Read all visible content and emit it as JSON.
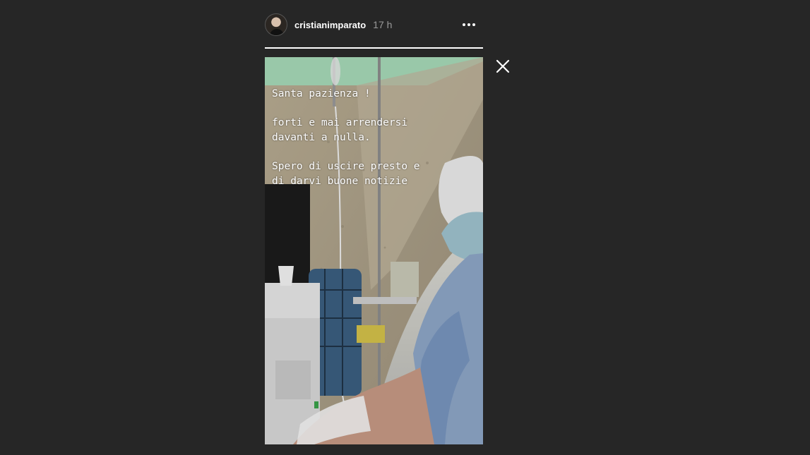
{
  "header": {
    "username": "cristianimparato",
    "time": "17 h"
  },
  "story": {
    "progress": 1.0,
    "lines": [
      "Santa pazienza !",
      "forti e mai arrendersi\ndavanti a nulla.",
      "Spero di uscire presto e\ndi darvi buone notizie"
    ]
  },
  "icons": {
    "more": "more-options-icon",
    "close": "close-icon",
    "avatar": "avatar"
  },
  "colors": {
    "background": "#262626",
    "text": "#ffffff",
    "time": "#9a9a9a"
  }
}
